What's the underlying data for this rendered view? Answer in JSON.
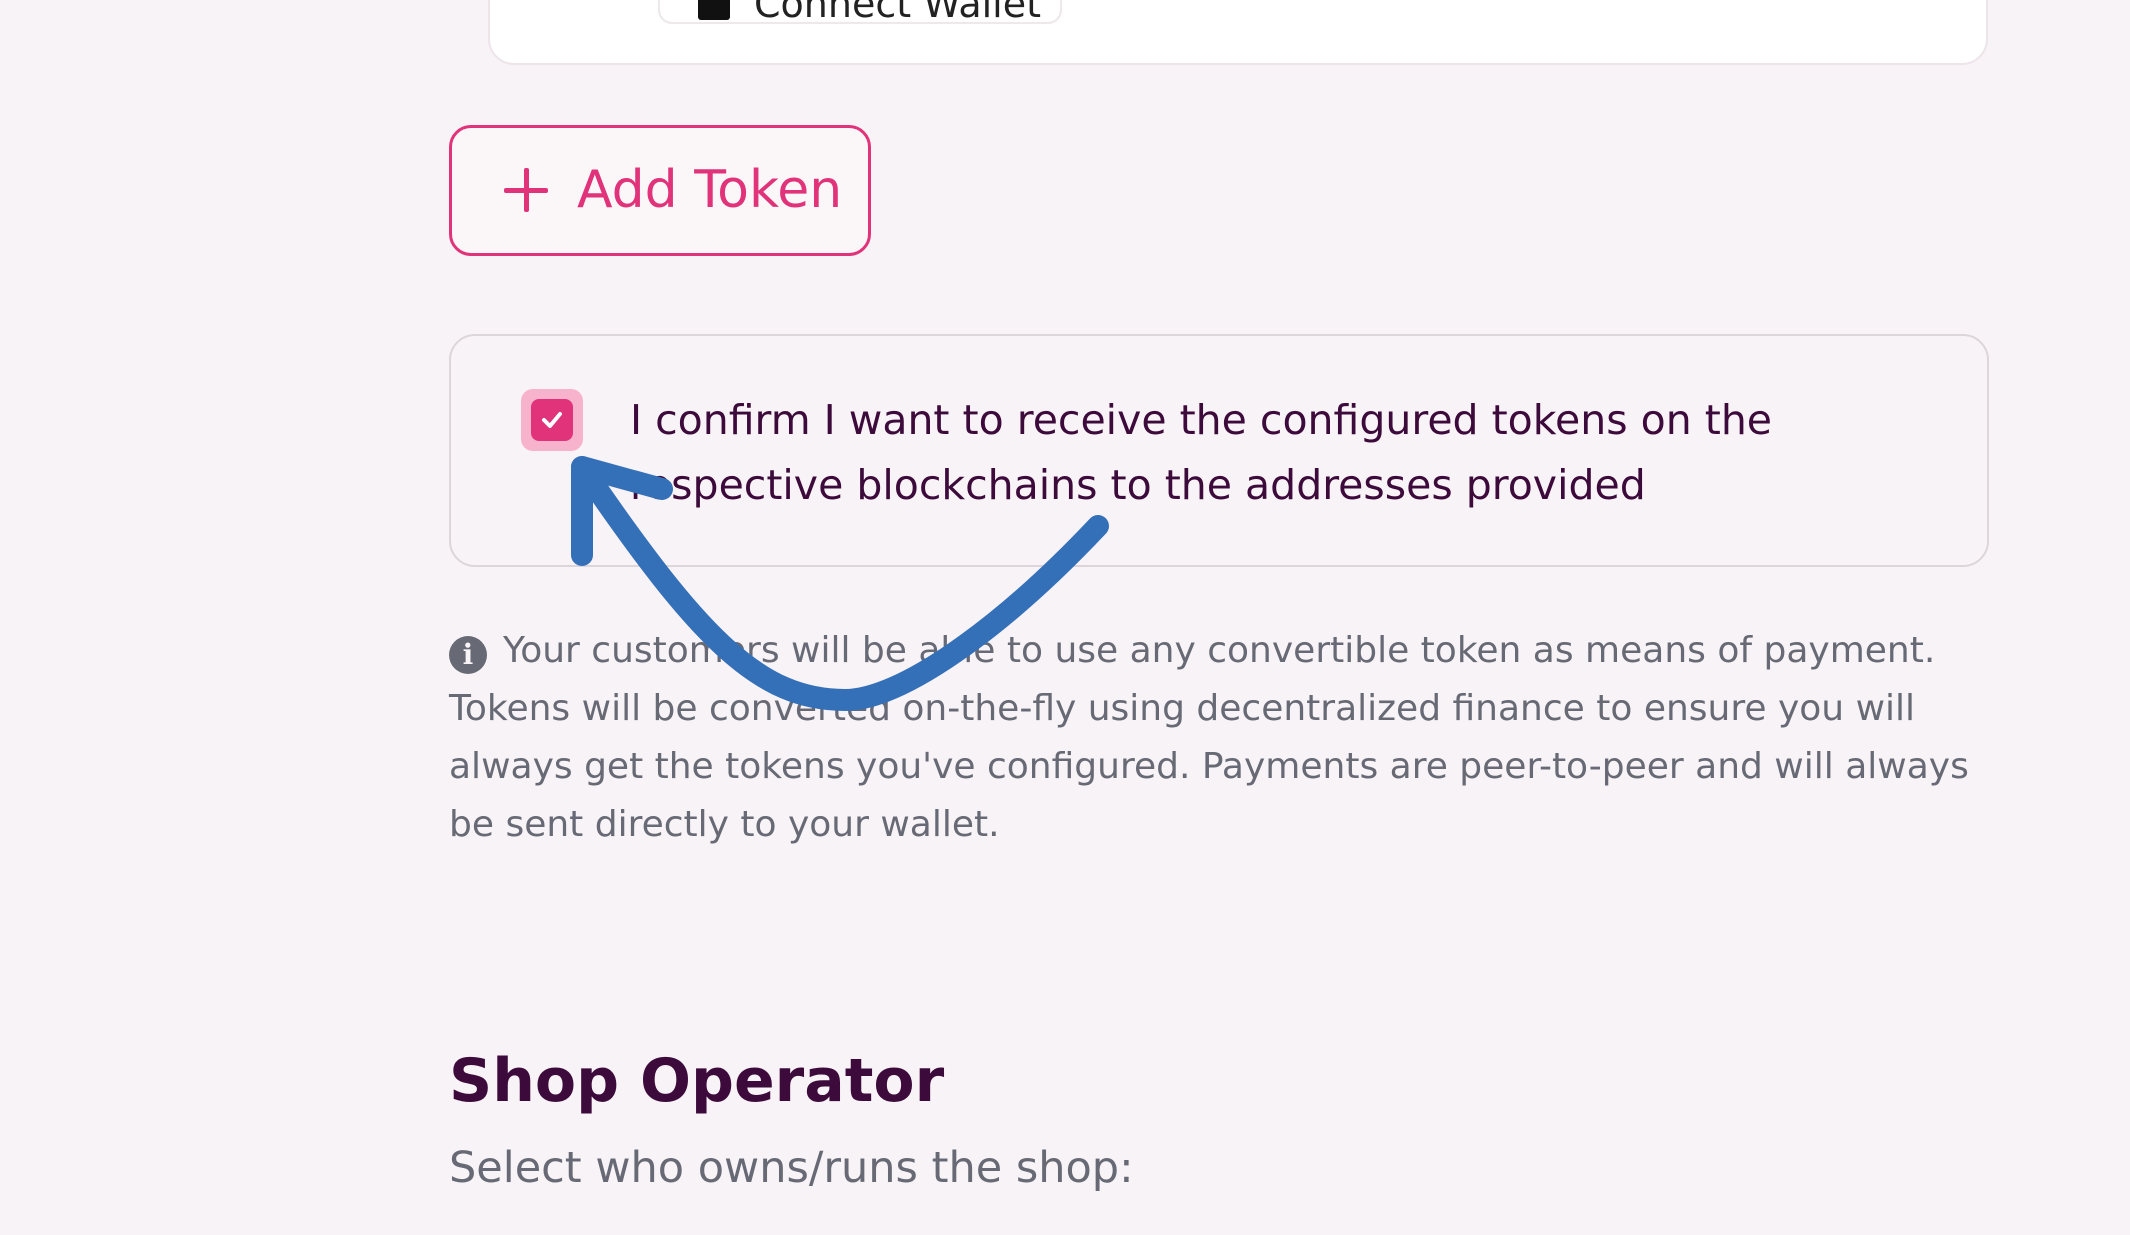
{
  "wallet_card": {
    "connect_wallet_label": "Connect Wallet"
  },
  "add_token": {
    "label": "Add Token"
  },
  "confirm": {
    "checked": true,
    "text": "I confirm I want to receive the configured tokens on the respective blockchains to the addresses provided"
  },
  "info": {
    "icon": "info-icon",
    "text": "Your customers will be able to use any convertible token as means of payment. Tokens will be converted on-the-fly using decentralized finance to ensure you will always get the tokens you've configured. Payments are peer-to-peer and will always be sent directly to your wallet."
  },
  "shop_operator": {
    "title": "Shop Operator",
    "subtitle": "Select who owns/runs the shop:"
  },
  "colors": {
    "accent": "#e0337a",
    "heading": "#3d0b3b",
    "muted_text": "#676a75",
    "background": "#f8f3f6",
    "annotation_arrow": "#3470b8"
  },
  "annotation": {
    "icon": "curved-arrow-icon"
  }
}
